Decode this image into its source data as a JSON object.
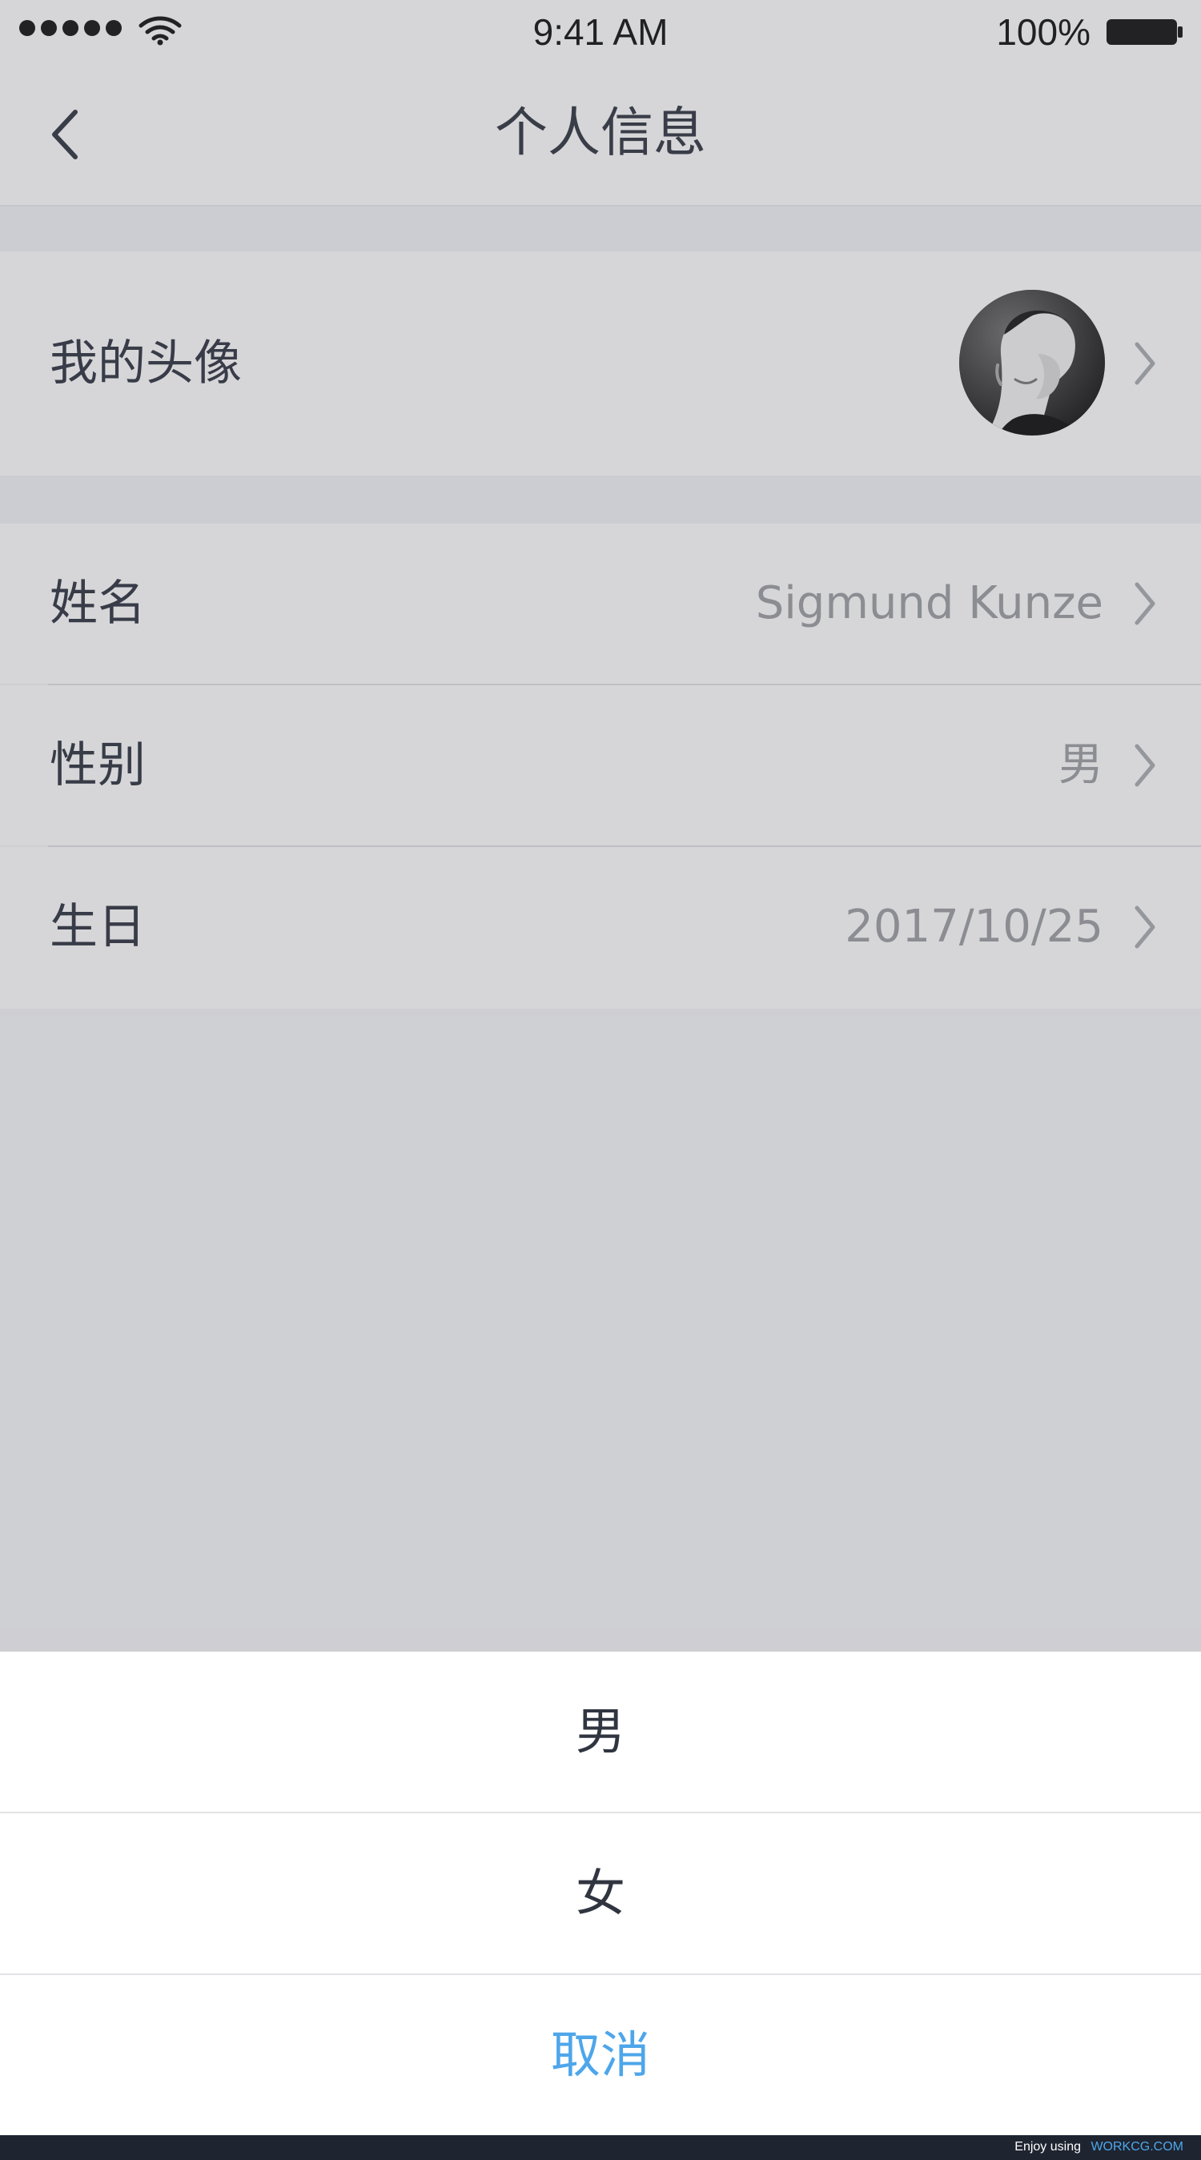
{
  "status_bar": {
    "time": "9:41 AM",
    "battery": "100%",
    "icons": [
      "signal-dots-icon",
      "wifi-icon",
      "battery-icon"
    ]
  },
  "nav": {
    "title": "个人信息",
    "back_icon": "chevron-left-icon"
  },
  "profile": {
    "avatar_label": "我的头像",
    "rows": [
      {
        "label": "姓名",
        "value": "Sigmund Kunze"
      },
      {
        "label": "性别",
        "value": "男"
      },
      {
        "label": "生日",
        "value": "2017/10/25"
      }
    ]
  },
  "action_sheet": {
    "options": [
      "男",
      "女"
    ],
    "cancel": "取消"
  },
  "watermark": {
    "prefix": "Enjoy using",
    "brand": "WORKCG.COM"
  },
  "colors": {
    "accent": "#4EA6EA",
    "text": "#2E3340",
    "muted": "#9A9CA1",
    "background": "#F2F3F5",
    "overlay": "rgba(90,92,98,0.23)"
  }
}
